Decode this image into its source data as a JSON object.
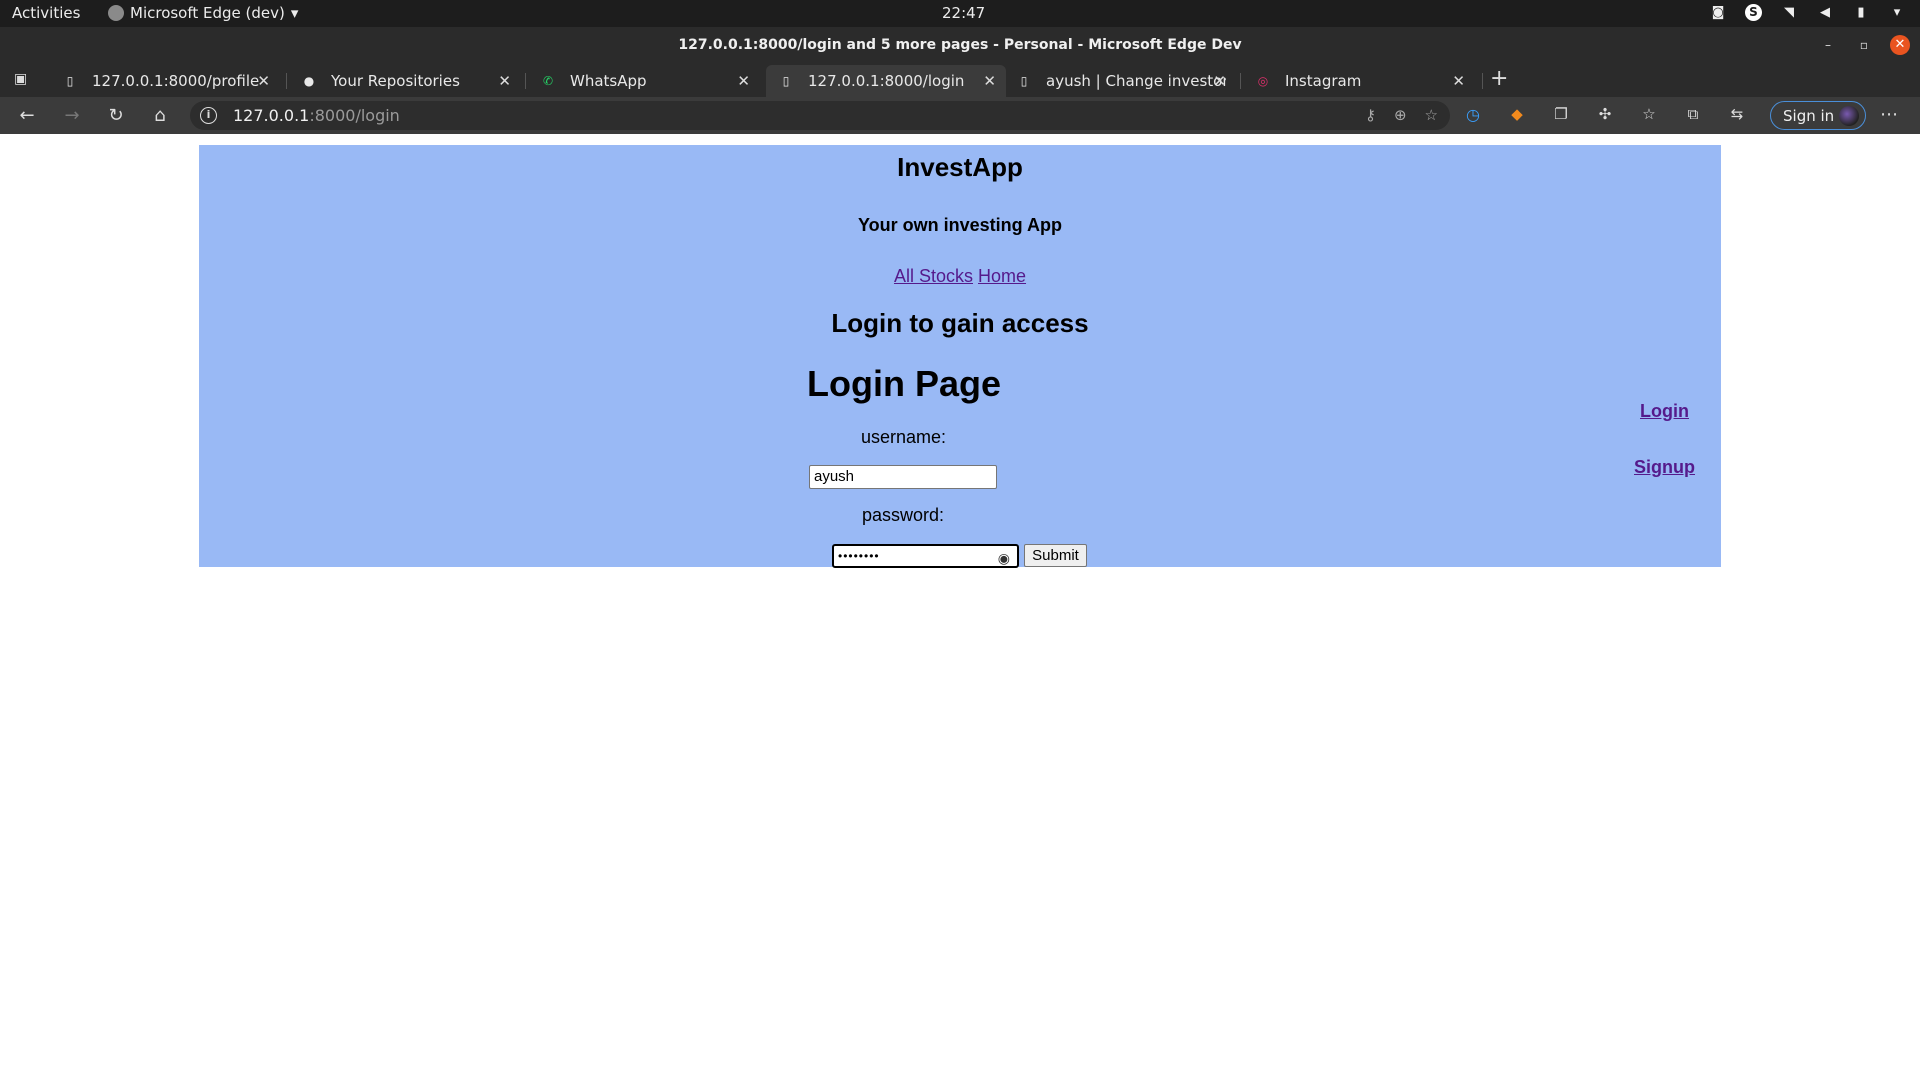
{
  "system_bar": {
    "activities": "Activities",
    "app_name": "Microsoft Edge (dev)",
    "clock": "22:47"
  },
  "window": {
    "title": "127.0.0.1:8000/login and 5 more pages - Personal - Microsoft Edge Dev"
  },
  "tabs": [
    {
      "label": "127.0.0.1:8000/profile",
      "icon": "page-icon"
    },
    {
      "label": "Your Repositories",
      "icon": "github-icon"
    },
    {
      "label": "WhatsApp",
      "icon": "whatsapp-icon"
    },
    {
      "label": "127.0.0.1:8000/login",
      "icon": "page-icon",
      "active": true
    },
    {
      "label": "ayush | Change investor |",
      "icon": "page-icon"
    },
    {
      "label": "Instagram",
      "icon": "instagram-icon"
    }
  ],
  "address_bar": {
    "host": "127.0.0.1",
    "path": ":8000/login"
  },
  "profile": {
    "signin_label": "Sign in"
  },
  "page": {
    "title": "InvestApp",
    "tagline": "Your own investing App",
    "nav": {
      "all_stocks": "All Stocks",
      "home": "Home"
    },
    "section_heading": "Login to gain access",
    "login_title": "Login Page",
    "username_label": "username:",
    "username_value": "ayush",
    "password_label": "password:",
    "password_mask": "••••••••",
    "submit_label": "Submit",
    "side_links": {
      "login": "Login",
      "signup": "Signup"
    }
  },
  "colors": {
    "panel_bg": "#99b9f5",
    "link": "#551a8b"
  }
}
